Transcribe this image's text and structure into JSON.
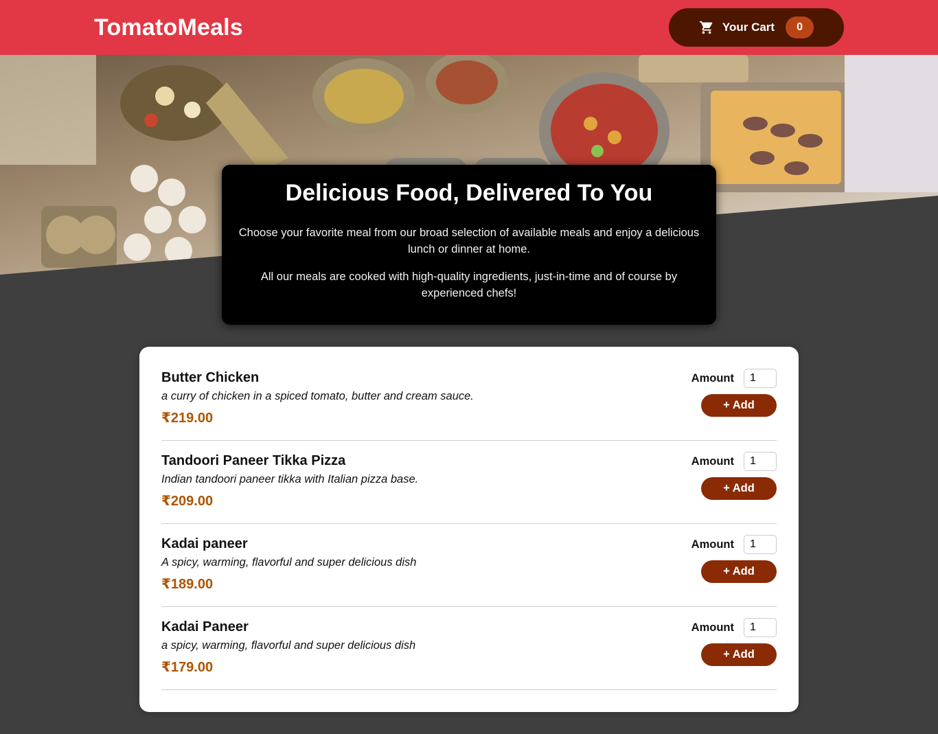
{
  "header": {
    "brand": "TomatoMeals",
    "cart": {
      "label": "Your Cart",
      "count": "0",
      "icon": "cart-icon"
    }
  },
  "hero": {
    "image_alt": "A table full of delicious food!"
  },
  "summary": {
    "title": "Delicious Food, Delivered To You",
    "paragraph1": "Choose your favorite meal from our broad selection of available meals and enjoy a delicious lunch or dinner at home.",
    "paragraph2": "All our meals are cooked with high-quality ingredients, just-in-time and of course by experienced chefs!"
  },
  "meals": [
    {
      "name": "Butter Chicken",
      "description": "a curry of chicken in a spiced tomato, butter and cream sauce.",
      "price": "₹219.00",
      "amount_label": "Amount",
      "amount_value": "1",
      "add_label": "+ Add"
    },
    {
      "name": "Tandoori Paneer Tikka Pizza",
      "description": "Indian tandoori paneer tikka with Italian pizza base.",
      "price": "₹209.00",
      "amount_label": "Amount",
      "amount_value": "1",
      "add_label": "+ Add"
    },
    {
      "name": "Kadai paneer",
      "description": "A spicy, warming, flavorful and super delicious dish",
      "price": "₹189.00",
      "amount_label": "Amount",
      "amount_value": "1",
      "add_label": "+ Add"
    },
    {
      "name": "Kadai Paneer",
      "description": "a spicy, warming, flavorful and super delicious dish",
      "price": "₹179.00",
      "amount_label": "Amount",
      "amount_value": "1",
      "add_label": "+ Add"
    }
  ],
  "colors": {
    "header_bg": "#e23744",
    "cart_bg": "#4d1601",
    "badge_bg": "#b94517",
    "page_bg": "#3f3f3f",
    "price": "#ad5502",
    "add_button": "#8a2b06"
  }
}
